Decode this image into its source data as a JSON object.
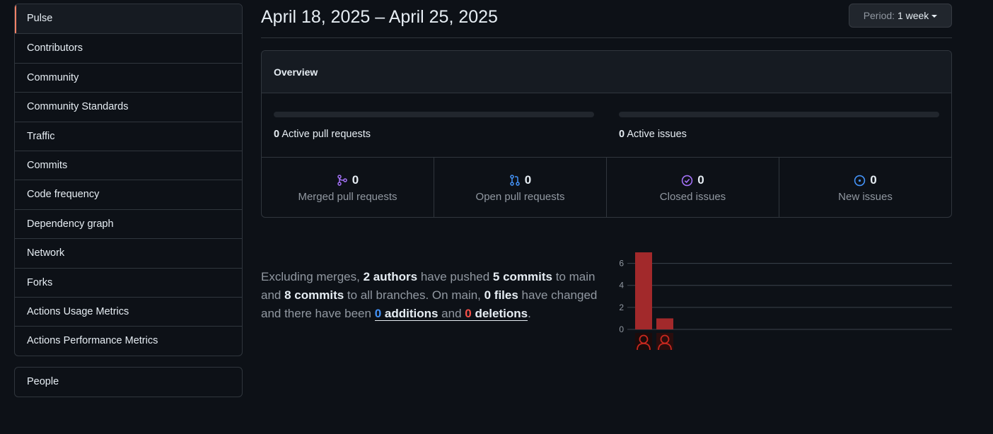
{
  "sidebar": {
    "items": [
      {
        "label": "Pulse",
        "selected": true
      },
      {
        "label": "Contributors"
      },
      {
        "label": "Community"
      },
      {
        "label": "Community Standards"
      },
      {
        "label": "Traffic"
      },
      {
        "label": "Commits"
      },
      {
        "label": "Code frequency"
      },
      {
        "label": "Dependency graph"
      },
      {
        "label": "Network"
      },
      {
        "label": "Forks"
      },
      {
        "label": "Actions Usage Metrics"
      },
      {
        "label": "Actions Performance Metrics"
      }
    ],
    "people_label": "People"
  },
  "header": {
    "date_range": "April 18, 2025 – April 25, 2025",
    "period_label": "Period:",
    "period_value": "1 week"
  },
  "overview": {
    "title": "Overview",
    "active_prs": {
      "count": "0",
      "label": "Active pull requests"
    },
    "active_issues": {
      "count": "0",
      "label": "Active issues"
    },
    "stats": [
      {
        "icon": "git-merge-icon",
        "count": "0",
        "label": "Merged pull requests",
        "color": "#a371f7"
      },
      {
        "icon": "git-pull-request-icon",
        "count": "0",
        "label": "Open pull requests",
        "color": "#4493f8"
      },
      {
        "icon": "issue-closed-icon",
        "count": "0",
        "label": "Closed issues",
        "color": "#a371f7"
      },
      {
        "icon": "issue-opened-icon",
        "count": "0",
        "label": "New issues",
        "color": "#4493f8"
      }
    ]
  },
  "summary": {
    "t1": "Excluding merges, ",
    "authors": "2 authors",
    "t2": " have pushed ",
    "commits_main": "5 commits",
    "t3": " to main and ",
    "commits_all": "8 commits",
    "t4": " to all branches. On main, ",
    "files": "0 files",
    "t5": " have changed and there have been ",
    "additions_num": "0",
    "additions_word": " additions",
    "and_word": " and ",
    "deletions_num": "0",
    "deletions_word": " deletions",
    "t6": "."
  },
  "chart_data": {
    "type": "bar",
    "categories": [
      "author-1",
      "author-2"
    ],
    "values": [
      7,
      1
    ],
    "yticks": [
      "0",
      "2",
      "4",
      "6"
    ],
    "ylim": [
      0,
      7
    ],
    "bar_color": "#a2292b",
    "grid": true
  }
}
